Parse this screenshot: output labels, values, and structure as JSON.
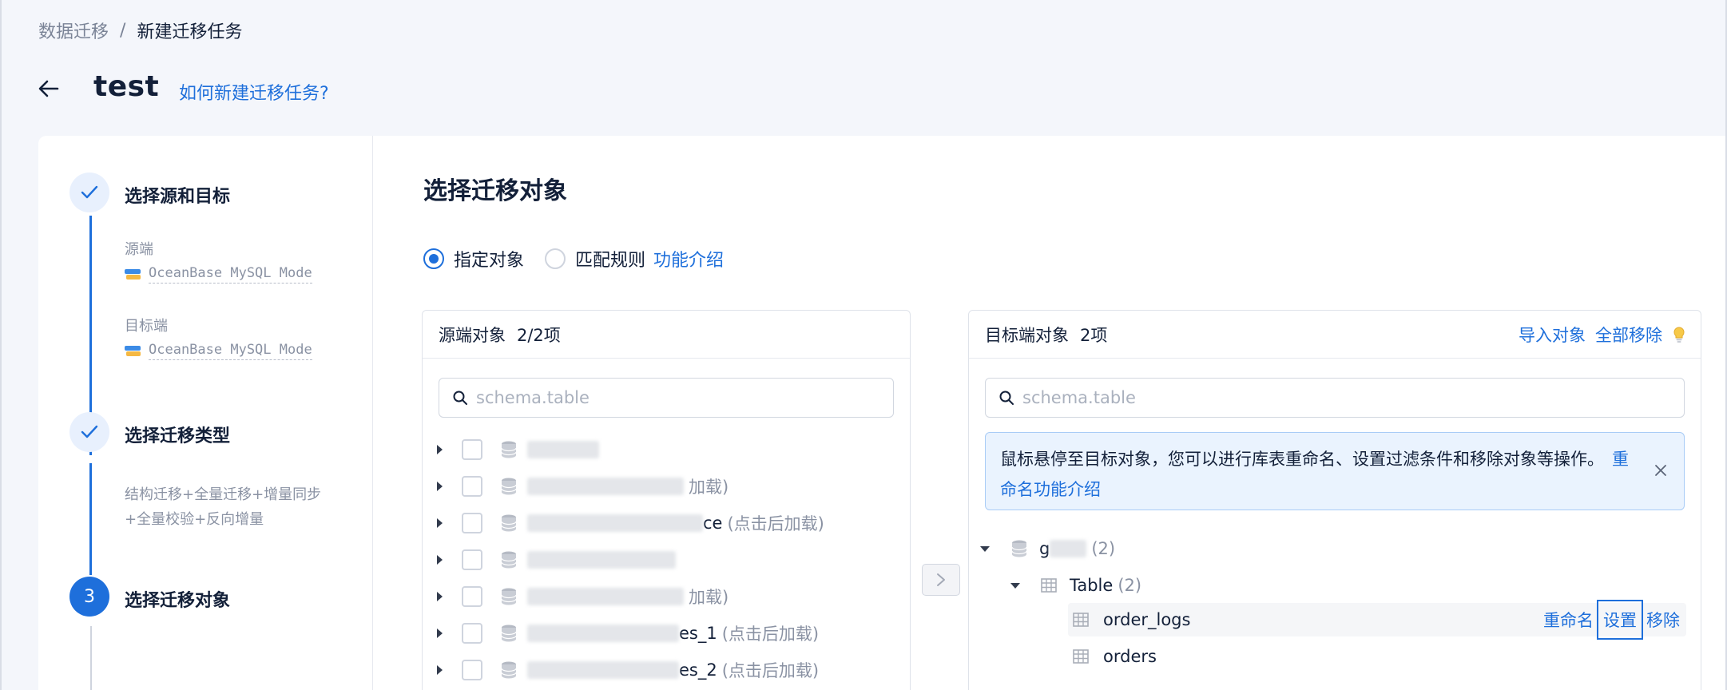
{
  "breadcrumb": {
    "parent": "数据迁移",
    "separator": "/",
    "current": "新建迁移任务"
  },
  "header": {
    "title": "test",
    "help_link": "如何新建迁移任务?"
  },
  "steps": [
    {
      "index": "1",
      "title": "选择源和目标",
      "status": "done",
      "source_label": "源端",
      "source_value": "OceanBase MySQL Mode",
      "target_label": "目标端",
      "target_value": "OceanBase MySQL Mode"
    },
    {
      "index": "2",
      "title": "选择迁移类型",
      "status": "done",
      "desc_line1": "结构迁移+全量迁移+增量同步",
      "desc_line2": "+全量校验+反向增量"
    },
    {
      "index": "3",
      "title": "选择迁移对象",
      "status": "active"
    }
  ],
  "content": {
    "title": "选择迁移对象",
    "modes": [
      {
        "label": "指定对象",
        "checked": true
      },
      {
        "label": "匹配规则",
        "checked": false
      }
    ],
    "feature_link": "功能介绍"
  },
  "source_panel": {
    "title": "源端对象",
    "count": "2/2项",
    "search_placeholder": "schema.table",
    "rows": [
      {
        "text": "",
        "hint": ""
      },
      {
        "text": "",
        "hint": "加载)"
      },
      {
        "text": "ce",
        "hint": "(点击后加载)"
      },
      {
        "text": "",
        "hint": ""
      },
      {
        "text": "",
        "hint": "加载)"
      },
      {
        "text": "es_1",
        "hint": "(点击后加载)"
      },
      {
        "text": "es_2",
        "hint": "(点击后加载)"
      }
    ]
  },
  "target_panel": {
    "title": "目标端对象",
    "count": "2项",
    "import_label": "导入对象",
    "remove_all_label": "全部移除",
    "search_placeholder": "schema.table",
    "alert_text": "鼠标悬停至目标对象，您可以进行库表重命名、设置过滤条件和移除对象等操作。",
    "alert_link": "重命名功能介绍",
    "tree": {
      "db_name": "g",
      "db_count": "(2)",
      "group_label": "Table",
      "group_count": "(2)",
      "tables": [
        "order_logs",
        "orders"
      ],
      "row_actions": {
        "rename": "重命名",
        "settings": "设置",
        "remove": "移除"
      }
    }
  },
  "colors": {
    "accent": "#1e6fdb",
    "muted": "#8a92a3",
    "text": "#132039"
  },
  "icons": [
    "back-arrow-icon",
    "check-icon",
    "search-icon",
    "database-icon",
    "table-icon",
    "close-icon",
    "bulb-icon",
    "chevron-right-icon",
    "oceanbase-logo-icon"
  ]
}
